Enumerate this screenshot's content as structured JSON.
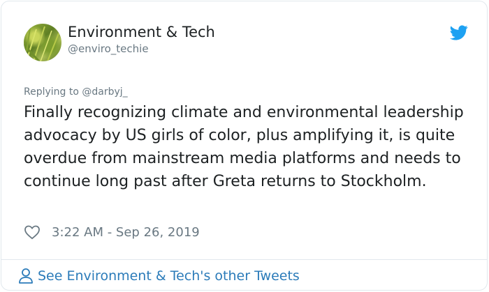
{
  "author": {
    "display_name": "Environment & Tech",
    "handle": "@enviro_techie",
    "avatar_icon": "avatar-photo-grass"
  },
  "platform_icon": "twitter-bird-icon",
  "reply": {
    "prefix": "Replying to ",
    "target": "@darbyj_"
  },
  "tweet": {
    "text": "Finally recognizing climate and environmental leadership advocacy by US girls of color, plus amplifying it, is quite overdue from mainstream media platforms and needs to continue long past after Greta returns to Stockholm.",
    "timestamp": "3:22 AM - Sep 26, 2019"
  },
  "footer": {
    "more_tweets_label": "See Environment & Tech's other Tweets"
  },
  "colors": {
    "text": "#1c2022",
    "muted": "#697882",
    "link": "#2b7bb9",
    "twitter_blue": "#1da1f2",
    "border": "#e1e8ed"
  }
}
